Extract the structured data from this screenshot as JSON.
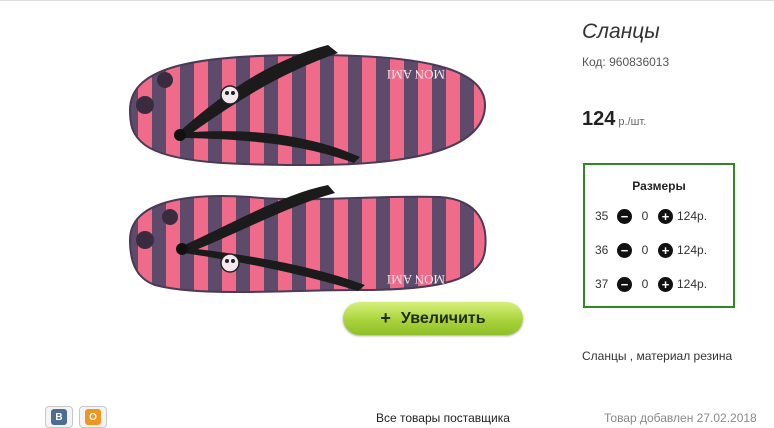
{
  "product": {
    "title": "Сланцы",
    "code_label": "Код:",
    "code_value": "960836013",
    "price_value": "124",
    "price_unit": "р./шт.",
    "zoom_label": "Увеличить",
    "zoom_icon": "+",
    "brand_print": "MON AMI",
    "description": "Сланцы , материал резина"
  },
  "sizes": {
    "title": "Размеры",
    "rows": [
      {
        "size": "35",
        "qty": "0",
        "price": "124р."
      },
      {
        "size": "36",
        "qty": "0",
        "price": "124р."
      },
      {
        "size": "37",
        "qty": "0",
        "price": "124р."
      }
    ]
  },
  "footer": {
    "all_goods": "Все товары поставщика",
    "added": "Товар добавлен 27.02.2018",
    "share_icons": [
      "vk-icon",
      "odnoklassniki-icon"
    ],
    "vk_glyph": "В",
    "ok_glyph": "О"
  },
  "colors": {
    "accent_green": "#2d8a1e",
    "button_green": "#a9d33c",
    "stripe_pink": "#f06a8a",
    "stripe_purple": "#5e4a6a"
  }
}
